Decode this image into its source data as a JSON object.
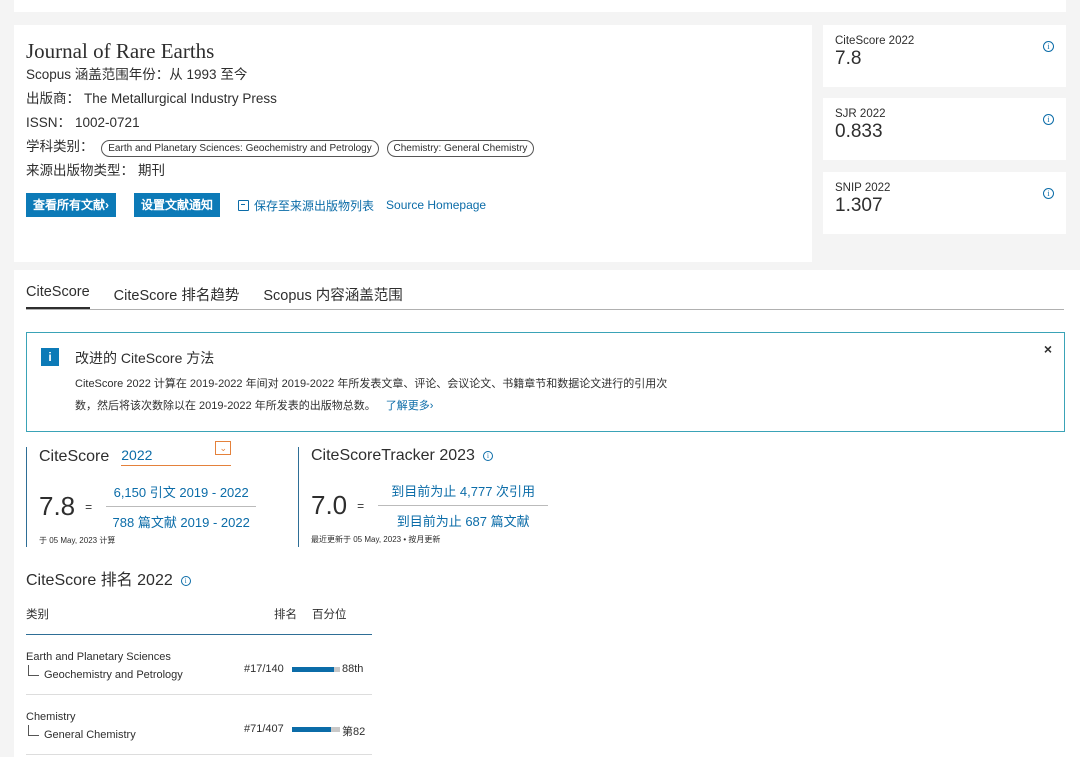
{
  "journal": {
    "title": "Journal of Rare Earths",
    "coverage_label": "Scopus 涵盖范围年份：",
    "coverage_value": "从 1993 至今",
    "publisher_label": "出版商：",
    "publisher_value": "The Metallurgical Industry Press",
    "issn_label": "ISSN：",
    "issn_value": "1002-0721",
    "subject_label": "学科类别：",
    "subjects": [
      "Earth and Planetary Sciences: Geochemistry and Petrology",
      "Chemistry: General Chemistry"
    ],
    "type_label": "来源出版物类型：",
    "type_value": "期刊"
  },
  "actions": {
    "view_all": "查看所有文献›",
    "set_alert": "设置文献通知",
    "save_list": "保存至来源出版物列表",
    "homepage": "Source Homepage"
  },
  "metrics": [
    {
      "label": "CiteScore 2022",
      "value": "7.8"
    },
    {
      "label": "SJR 2022",
      "value": "0.833"
    },
    {
      "label": "SNIP 2022",
      "value": "1.307"
    }
  ],
  "tabs": [
    "CiteScore",
    "CiteScore 排名趋势",
    "Scopus 内容涵盖范围"
  ],
  "notice": {
    "icon": "i",
    "title": "改进的 CiteScore 方法",
    "body": "CiteScore 2022 计算在 2019-2022 年间对 2019-2022 年所发表文章、评论、会议论文、书籍章节和数据论文进行的引用次数，然后将该次数除以在 2019-2022 年所发表的出版物总数。",
    "more": "了解更多›",
    "close": "×"
  },
  "citescore": {
    "label": "CiteScore",
    "year": "2022",
    "value": "7.8",
    "eq": "=",
    "numerator": "6,150 引文 2019 - 2022",
    "denominator": "788 篇文献 2019 - 2022",
    "footnote": "于 05 May, 2023 计算"
  },
  "tracker": {
    "label": "CiteScoreTracker 2023",
    "value": "7.0",
    "eq": "=",
    "numerator": "到目前为止 4,777 次引用",
    "denominator": "到目前为止 687 篇文献",
    "footnote": "最近更新于 05 May, 2023 • 按月更新"
  },
  "ranking": {
    "title": "CiteScore 排名 2022",
    "col_category": "类别",
    "col_rank": "排名",
    "col_pct": "百分位",
    "rows": [
      {
        "category": "Earth and Planetary Sciences",
        "sub": "Geochemistry and Petrology",
        "rank": "#17/140",
        "pct_label": "88th",
        "pct": 88
      },
      {
        "category": "Chemistry",
        "sub": "General Chemistry",
        "rank": "#71/407",
        "pct_label": "第82",
        "pct": 82
      }
    ]
  }
}
